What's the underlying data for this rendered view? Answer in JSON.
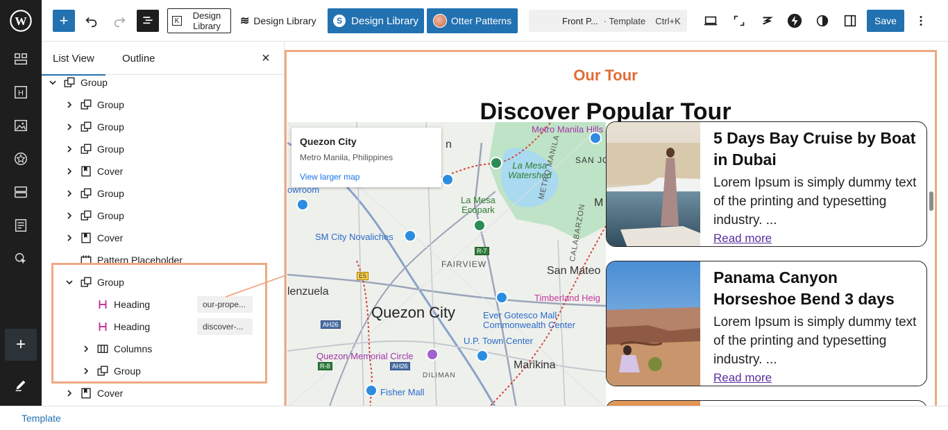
{
  "toolbar": {
    "design_library_outline": "Design Library",
    "design_library_text": "Design Library",
    "design_library_blue": "Design Library",
    "otter_patterns": "Otter Patterns",
    "doc_title": "Front P...",
    "doc_type": "· Template",
    "shortcut": "Ctrl+K",
    "save": "Save"
  },
  "panel": {
    "tabs": [
      "List View",
      "Outline"
    ],
    "rows": [
      {
        "label": "Group"
      },
      {
        "label": "Group"
      },
      {
        "label": "Group"
      },
      {
        "label": "Group"
      },
      {
        "label": "Cover"
      },
      {
        "label": "Group"
      },
      {
        "label": "Group"
      },
      {
        "label": "Cover"
      },
      {
        "label": "Pattern Placeholder"
      },
      {
        "label": "Group"
      },
      {
        "label": "Heading",
        "badge": "our-prope..."
      },
      {
        "label": "Heading",
        "badge": "discover-..."
      },
      {
        "label": "Columns"
      },
      {
        "label": "Group"
      },
      {
        "label": "Cover"
      }
    ]
  },
  "footer": {
    "breadcrumb": "Template"
  },
  "canvas": {
    "eyebrow": "Our Tour",
    "headline": "Discover Popular Tour",
    "map": {
      "place": "Quezon City",
      "region": "Metro Manila, Philippines",
      "link": "View larger map",
      "labels": {
        "quezon_city": "Quezon City",
        "fairview": "FAIRVIEW",
        "san_mateo": "San Mateo",
        "marikina": "Marikina",
        "valenzuela": "lenzuela",
        "la_mesa_watershed": "La Mesa\nWatershed",
        "la_mesa_ecopark": "La Mesa\nEcopark",
        "sm_novaliches": "SM City Novaliches",
        "timberland": "Timberland Heig",
        "ever_gotesco": "Ever Gotesco Mall\nCommonwealth Center",
        "up_town": "U.P. Town Center",
        "memorial_circle": "Quezon Memorial Circle",
        "diliman": "DILIMAN",
        "fisher_mall": "Fisher Mall",
        "metro_manila_hills": "Metro Manila\nHills Fountain",
        "showroom": "owroom",
        "metro_manila_caps": "METRO MANILA",
        "calabarzon": "CALABARZON",
        "san_caps": "SAN JO",
        "m_edge": "M",
        "n_edge": "n"
      },
      "shields": {
        "r7": "R-7",
        "e5": "E5",
        "ah26a": "AH26",
        "r8": "R-8",
        "ah26b": "AH26"
      }
    },
    "tours": [
      {
        "title": "5 Days Bay Cruise by Boat in Dubai",
        "excerpt": "Lorem Ipsum is simply dummy text of the printing and typesetting industry. ...",
        "link": "Read more"
      },
      {
        "title": "Panama Canyon Horseshoe Bend 3 days",
        "excerpt": "Lorem Ipsum is simply dummy text of the printing and typesetting industry. ...",
        "link": "Read more"
      }
    ]
  },
  "colors": {
    "accent": "#2271b1",
    "highlight": "#f0a882",
    "eyebrow": "#e26c35",
    "sidebar": "#1e1e1e"
  }
}
